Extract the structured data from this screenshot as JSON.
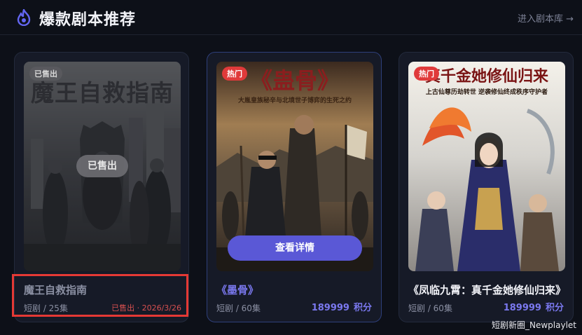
{
  "header": {
    "title": "爆款剧本推荐",
    "more_link": "进入剧本库 →",
    "icon": "flame-icon",
    "accent_color": "#6366f1"
  },
  "cards": [
    {
      "poster_title": "魔王自救指南",
      "badge": "已售出",
      "sold_chip": "已售出",
      "name": "魔王自救指南",
      "meta": "短剧 / 25集",
      "sold_info": "已售出 · 2026/3/26",
      "status": "sold",
      "highlighted": true
    },
    {
      "poster_title": "《蛊骨》",
      "poster_subtitle": "大胤皇族秘辛与北境世子博弈的生死之约",
      "badge": "热门",
      "button": "查看详情",
      "name": "《墨骨》",
      "meta": "短剧 / 60集",
      "price": "189999",
      "price_unit": "积分",
      "status": "hot"
    },
    {
      "poster_title": "真千金她修仙归来",
      "poster_subtitle": "上古仙尊历劫转世 逆袭修仙终成秩序守护者",
      "badge": "热门",
      "name": "《凤临九霄：真千金她修仙归来》",
      "meta": "短剧 / 60集",
      "price": "189999",
      "price_unit": "积分",
      "status": "hot"
    }
  ],
  "watermark": "短剧新圈_Newplaylet",
  "colors": {
    "background": "#0d1018",
    "card": "#161a27",
    "price": "#7a78ee",
    "hot_badge": "#e03a3a",
    "sold_text": "#d95050",
    "highlight": "#e53935",
    "button": "#5a58d6"
  }
}
